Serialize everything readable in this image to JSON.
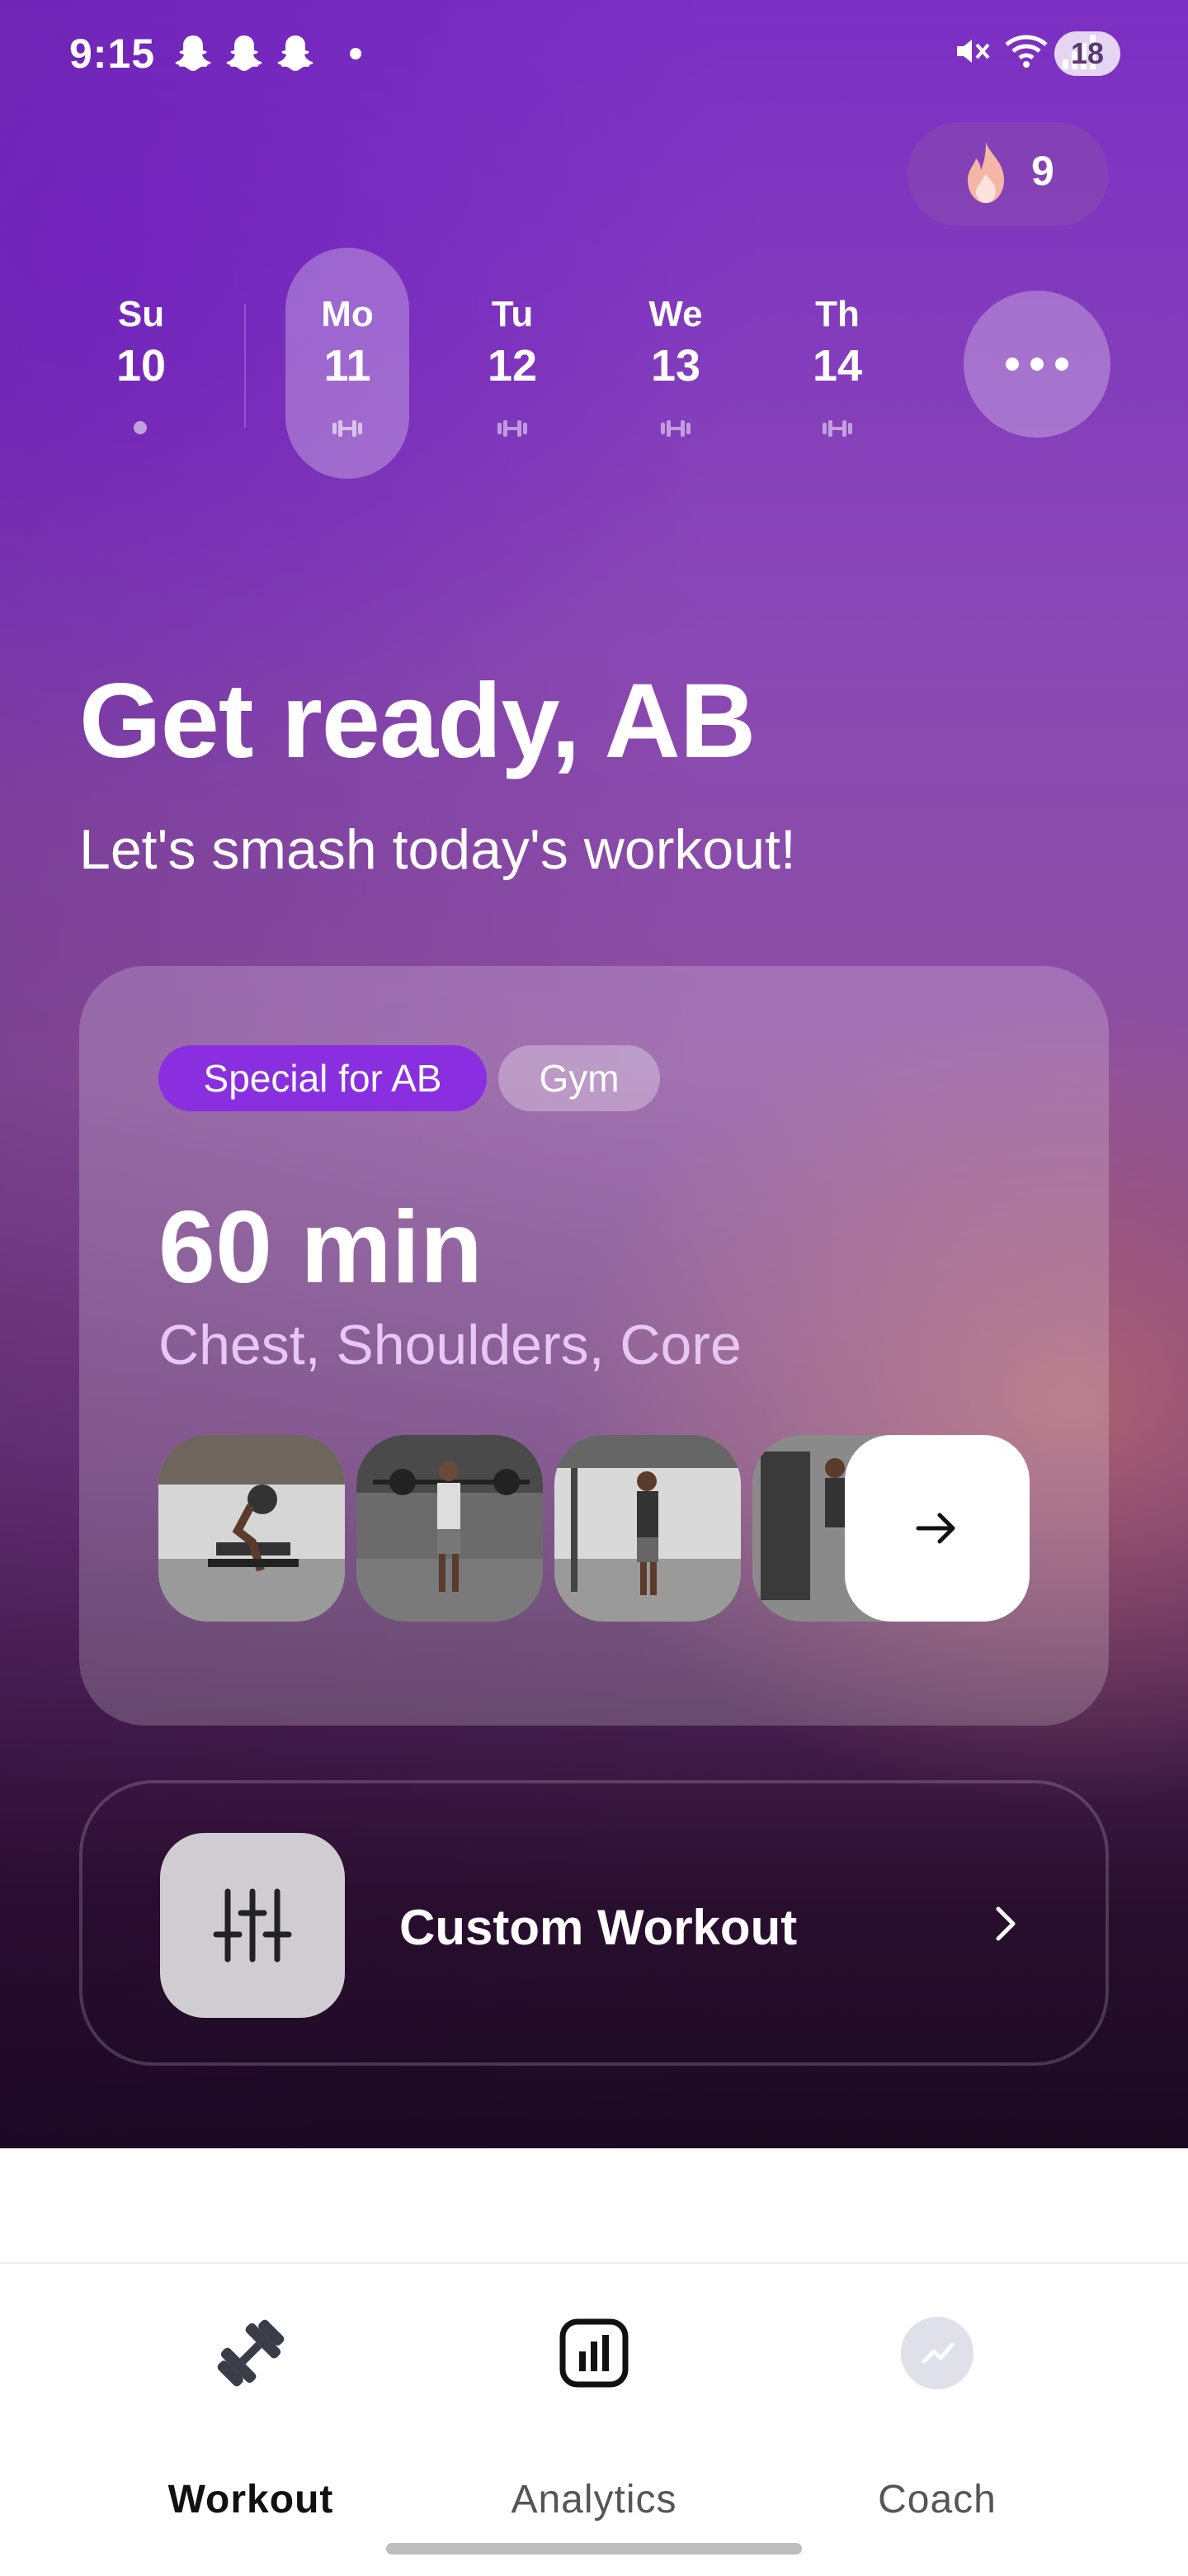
{
  "status_bar": {
    "time": "9:15",
    "battery": "18",
    "icons": [
      "snapchat-icon",
      "snapchat-icon",
      "snapchat-icon",
      "mute-icon",
      "wifi-icon",
      "signal-icon"
    ]
  },
  "streak": {
    "count": "9",
    "icon": "flame-icon"
  },
  "days": [
    {
      "name": "Su",
      "number": "10",
      "selected": false
    },
    {
      "name": "Mo",
      "number": "11",
      "selected": true
    },
    {
      "name": "Tu",
      "number": "12",
      "selected": false
    },
    {
      "name": "We",
      "number": "13",
      "selected": false
    },
    {
      "name": "Th",
      "number": "14",
      "selected": false
    }
  ],
  "hero": {
    "greeting": "Get ready, AB",
    "subtitle": "Let's smash today's workout!"
  },
  "workout_card": {
    "tags": [
      "Special for AB",
      "Gym"
    ],
    "duration": "60 min",
    "muscles": "Chest, Shoulders, Core",
    "thumbnails": [
      "exercise-thumbnail",
      "exercise-thumbnail",
      "exercise-thumbnail",
      "exercise-thumbnail"
    ]
  },
  "custom_workout": {
    "label": "Custom Workout"
  },
  "nav": {
    "items": [
      {
        "label": "Workout",
        "icon": "dumbbell-icon",
        "active": true
      },
      {
        "label": "Analytics",
        "icon": "bar-chart-icon",
        "active": false
      },
      {
        "label": "Coach",
        "icon": "coach-icon",
        "active": false
      }
    ]
  },
  "colors": {
    "accent": "#8a2fe0",
    "hero_top": "#7b2fc4",
    "hero_bottom": "#1a0a20"
  }
}
